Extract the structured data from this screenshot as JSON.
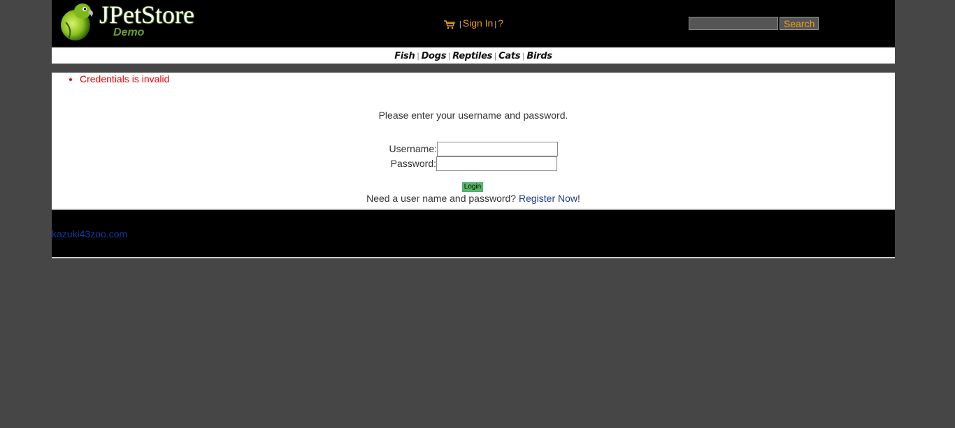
{
  "header": {
    "logo_title": "JPetStore",
    "logo_subtitle": "Demo",
    "menu": {
      "sign_in": "Sign In",
      "separator": "|",
      "help": "?"
    },
    "search": {
      "value": "",
      "button_label": "Search"
    }
  },
  "quicklinks": [
    "Fish",
    "Dogs",
    "Reptiles",
    "Cats",
    "Birds"
  ],
  "messages": [
    "Credentials is invalid"
  ],
  "login": {
    "prompt": "Please enter your username and password.",
    "username_label": "Username:",
    "password_label": "Password:",
    "username_value": "",
    "password_value": "",
    "button_label": "Login",
    "register_text": "Need a user name and password?",
    "register_link": "Register Now",
    "register_suffix": "!"
  },
  "footer": {
    "link": "kazuki43zoo.com"
  },
  "colors": {
    "page_background": "#464646",
    "header_background": "#000000",
    "accent_orange": "#f0a010",
    "error_red": "#ee0000",
    "login_button_green": "#5cb85c",
    "link_blue": "#1a3a8c"
  },
  "icons": {
    "logo": "parrot-logo",
    "cart": "cart-icon"
  }
}
